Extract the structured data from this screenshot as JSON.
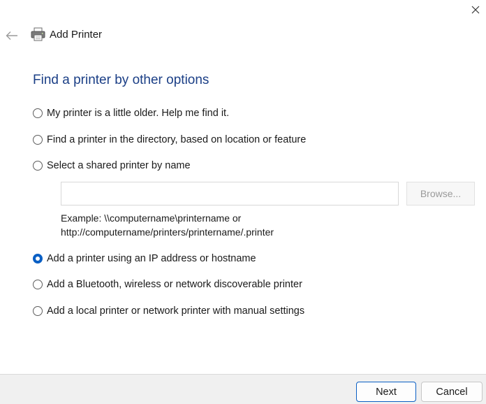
{
  "window": {
    "title": "Add Printer"
  },
  "heading": "Find a printer by other options",
  "options": [
    {
      "label": "My printer is a little older. Help me find it.",
      "checked": false
    },
    {
      "label": "Find a printer in the directory, based on location or feature",
      "checked": false
    },
    {
      "label": "Select a shared printer by name",
      "checked": false
    },
    {
      "label": "Add a printer using an IP address or hostname",
      "checked": true
    },
    {
      "label": "Add a Bluetooth, wireless or network discoverable printer",
      "checked": false
    },
    {
      "label": "Add a local printer or network printer with manual settings",
      "checked": false
    }
  ],
  "shared_printer": {
    "value": "",
    "browse_label": "Browse...",
    "example_line1": "Example: \\\\computername\\printername or",
    "example_line2": "http://computername/printers/printername/.printer"
  },
  "footer": {
    "next_label": "Next",
    "cancel_label": "Cancel"
  },
  "colors": {
    "heading": "#1b3f86",
    "accent": "#0a5fc4",
    "footer_bg": "#f0f0f0"
  }
}
